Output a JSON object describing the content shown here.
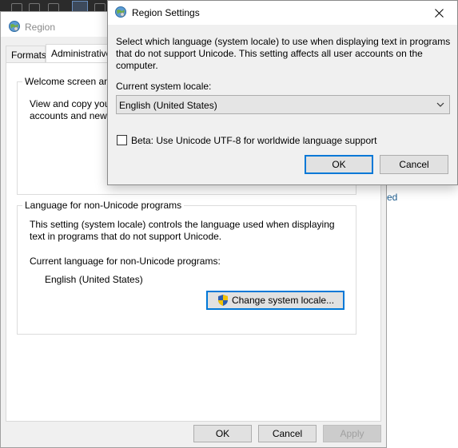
{
  "region": {
    "title": "Region",
    "tabs": [
      {
        "label": "Formats"
      },
      {
        "label": "Administrative"
      }
    ],
    "welcome": {
      "title": "Welcome screen and",
      "line1": "View and copy you",
      "line2": "accounts and new"
    },
    "nonunicode": {
      "title": "Language for non-Unicode programs",
      "desc_line1": "This setting (system locale) controls the language used when displaying",
      "desc_line2": "text in programs that do not support Unicode.",
      "current_label": "Current language for non-Unicode programs:",
      "current_value": "English (United States)",
      "change_button": "Change system locale..."
    },
    "buttons": {
      "ok": "OK",
      "cancel": "Cancel",
      "apply": "Apply"
    }
  },
  "background": {
    "right_text": "ed"
  },
  "dialog": {
    "title": "Region Settings",
    "desc_line1": "Select which language (system locale) to use when displaying text in programs",
    "desc_line2": "that do not support Unicode. This setting affects all user accounts on the",
    "desc_line3": "computer.",
    "locale_label": "Current system locale:",
    "locale_value": "English (United States)",
    "beta_label": "Beta: Use Unicode UTF-8 for worldwide language support",
    "beta_checked": false,
    "ok": "OK",
    "cancel": "Cancel"
  },
  "icons": {
    "title_icon": "globe-icon",
    "shield": "uac-shield-icon",
    "close": "close-icon",
    "dropdown": "chevron-down-icon"
  },
  "colors": {
    "focus_border": "#0078d7",
    "link_blue": "#1c5c8e",
    "shield_blue": "#2a5db0",
    "shield_yellow": "#f2c200"
  }
}
